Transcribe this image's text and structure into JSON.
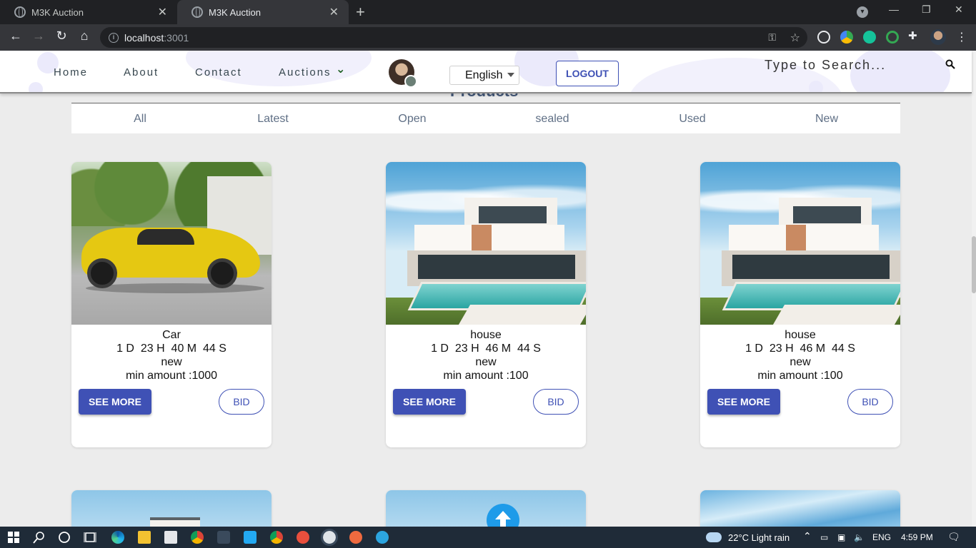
{
  "browser": {
    "tabs": [
      {
        "title": "M3K Auction",
        "active": false
      },
      {
        "title": "M3K Auction",
        "active": true
      }
    ],
    "url_host": "localhost",
    "url_port": ":3001"
  },
  "nav": {
    "links": [
      "Home",
      "About",
      "Contact",
      "Auctions"
    ],
    "language": "English",
    "logout_label": "LOGOUT",
    "search_placeholder": "Type to Search..."
  },
  "section_heading": "Products",
  "filters": [
    "All",
    "Latest",
    "Open",
    "sealed",
    "Used",
    "New"
  ],
  "products": [
    {
      "name": "Car",
      "countdown": "1 D  23 H  40 M  44 S",
      "condition": "new",
      "min_amount": "min amount :1000",
      "see_more_label": "SEE MORE",
      "bid_label": "BID",
      "image": "yellow-sports-car"
    },
    {
      "name": "house",
      "countdown": "1 D  23 H  46 M  44 S",
      "condition": "new",
      "min_amount": "min amount :100",
      "see_more_label": "SEE MORE",
      "bid_label": "BID",
      "image": "modern-house-with-pool"
    },
    {
      "name": "house",
      "countdown": "1 D  23 H  46 M  44 S",
      "condition": "new",
      "min_amount": "min amount :100",
      "see_more_label": "SEE MORE",
      "bid_label": "BID",
      "image": "modern-house-with-pool"
    }
  ],
  "taskbar": {
    "weather": "22°C  Light rain",
    "language": "ENG",
    "time": "4:59 PM"
  },
  "colors": {
    "primary": "#3f51b5",
    "fab": "#1e9be9",
    "chrome_dark": "#202124",
    "taskbar": "#1f2b38"
  }
}
